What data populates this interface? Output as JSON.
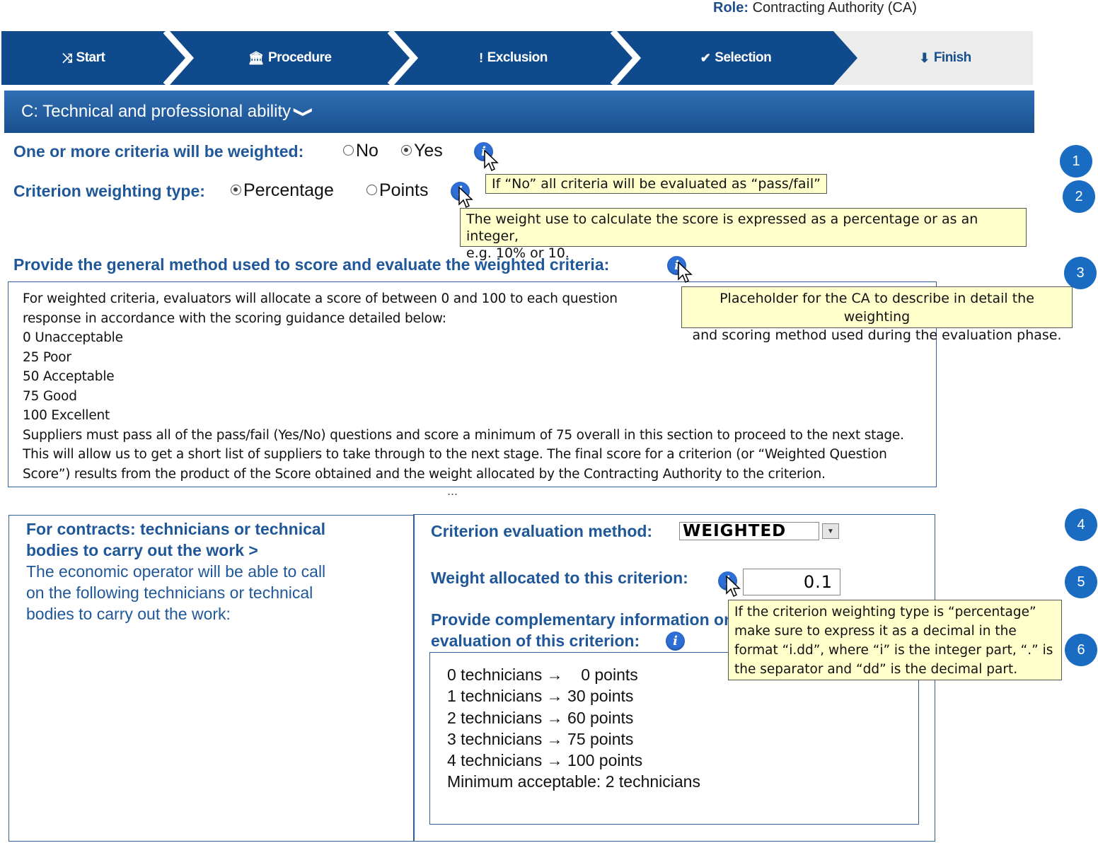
{
  "role": {
    "label": "Role:",
    "value": "Contracting Authority (CA)"
  },
  "wizard": {
    "steps": [
      {
        "label": "Start",
        "icon": "shuffle-icon",
        "glyph": "⤨"
      },
      {
        "label": "Procedure",
        "icon": "bank-icon",
        "glyph": "🏛"
      },
      {
        "label": "Exclusion",
        "icon": "exclamation-icon",
        "glyph": "!"
      },
      {
        "label": "Selection",
        "icon": "check-circle-icon",
        "glyph": "✔"
      },
      {
        "label": "Finish",
        "icon": "download-icon",
        "glyph": "⬇"
      }
    ],
    "colors": {
      "active": "#0f4a8d",
      "inactive": "#ececec",
      "separator": "#ffffff"
    }
  },
  "section": {
    "title": "C: Technical and professional ability",
    "chevron": "❯"
  },
  "weighted_question": {
    "label": "One or more criteria will be weighted:",
    "options": [
      "No",
      "Yes"
    ],
    "selected": "Yes",
    "tooltip": "If “No” all criteria will be evaluated as “pass/fail”"
  },
  "weighting_type": {
    "label": "Criterion weighting type:",
    "options": [
      "Percentage",
      "Points"
    ],
    "selected": "Percentage",
    "tooltip_lines": [
      "The weight use to calculate the score is expressed as a percentage or as an integer,",
      "e.g. 10% or 10."
    ]
  },
  "general_method": {
    "label": "Provide the general method used to score and evaluate the weighted criteria:",
    "tooltip_lines": [
      "Placeholder for the CA to describe in detail the weighting",
      "and scoring method used during the evaluation phase."
    ],
    "text_lines": [
      "For weighted criteria, evaluators will allocate a score of between 0 and 100 to each question",
      "response in accordance with the scoring guidance detailed below:",
      "0 Unacceptable",
      "25 Poor",
      "50 Acceptable",
      "75 Good",
      "100 Excellent",
      "Suppliers must pass all of the pass/fail (Yes/No) questions and score a minimum of 75 overall in this section to proceed to the next stage.",
      "This will allow us to get a short list of suppliers to take through to the next stage. The final score for a criterion (or “Weighted Question",
      "Score”) results from the product of the Score obtained and the weight allocated by the Contracting Authority to the criterion."
    ],
    "ellipsis": "..."
  },
  "criterion": {
    "title_lines": [
      "For contracts: technicians or technical",
      "bodies to carry out the work >"
    ],
    "desc_lines": [
      "The economic operator will be able to call",
      "on the following technicians or technical",
      "bodies to carry out the work:"
    ],
    "evaluation_method_label": "Criterion evaluation method:",
    "evaluation_method_value": "WEIGHTED",
    "weight_label": "Weight allocated to this criterion:",
    "weight_value": "0.1",
    "weight_tooltip_lines": [
      "If the criterion weighting type is “percentage”",
      "make sure to express it as a decimal in the",
      "format “i.dd”, where “i” is the integer part, “.” is",
      "the separator and “dd” is the decimal part."
    ],
    "complementary_label_lines": [
      "Provide complementary information on the",
      "evaluation of this criterion:"
    ],
    "complementary_lines": [
      "0 technicians →    0 points",
      "1 technicians → 30 points",
      "2 technicians → 60 points",
      "3 technicians → 75 points",
      "4 technicians → 100 points",
      "",
      "Minimum acceptable: 2 technicians"
    ]
  },
  "badges": [
    "1",
    "2",
    "3",
    "4",
    "5",
    "6"
  ]
}
